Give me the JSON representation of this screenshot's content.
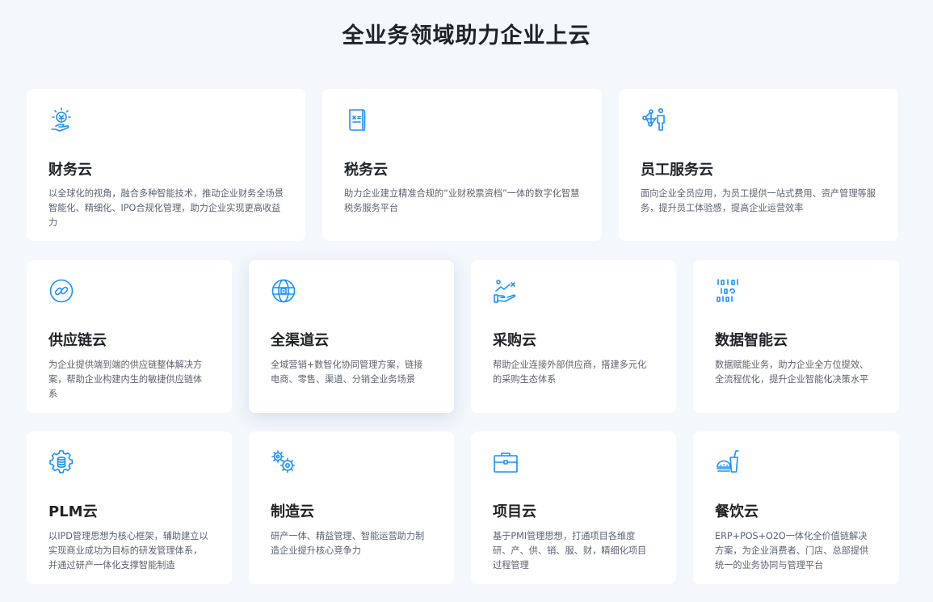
{
  "page": {
    "title": "全业务领域助力企业上云"
  },
  "colors": {
    "accent": "#1890ff",
    "background": "#f4f7fc",
    "card": "#ffffff"
  },
  "cards": [
    {
      "icon": "finance-coin-hand-icon",
      "title": "财务云",
      "desc": "以全球化的视角，融合多种智能技术，推动企业财务全场景智能化、精细化、IPO合规化管理，助力企业实现更高收益力"
    },
    {
      "icon": "tax-receipt-icon",
      "title": "税务云",
      "desc": "助力企业建立精准合规的“业财税票资档”一体的数字化智慧税务服务平台"
    },
    {
      "icon": "employee-network-icon",
      "title": "员工服务云",
      "desc": "面向企业全员应用，为员工提供一站式费用、资产管理等服务，提升员工体验感，提高企业运营效率"
    },
    {
      "icon": "supply-chain-link-icon",
      "title": "供应链云",
      "desc": "为企业提供端到端的供应链整体解决方案，帮助企业构建内生的敏捷供应链体系"
    },
    {
      "icon": "omnichannel-globe-icon",
      "title": "全渠道云",
      "desc": "全域营销+数智化协同管理方案，链接电商、零售、渠道、分销全业务场景"
    },
    {
      "icon": "procurement-hand-chart-icon",
      "title": "采购云",
      "desc": "帮助企业连接外部供应商，搭建多元化的采购生态体系"
    },
    {
      "icon": "binary-data-icon",
      "title": "数据智能云",
      "desc": "数据赋能业务，助力企业全方位提效、全流程优化，提升企业智能化决策水平"
    },
    {
      "icon": "database-gear-icon",
      "title": "PLM云",
      "desc": "以IPD管理思想为核心框架，辅助建立以实现商业成功为目标的研发管理体系，并通过研产一体化支撑智能制造"
    },
    {
      "icon": "gears-icon",
      "title": "制造云",
      "desc": "研产一体、精益管理、智能运营助力制造企业提升核心竞争力"
    },
    {
      "icon": "project-briefcase-icon",
      "title": "项目云",
      "desc": "基于PMI管理思想，打通项目各维度研、产、供、销、服、财，精细化项目过程管理"
    },
    {
      "icon": "catering-food-drink-icon",
      "title": "餐饮云",
      "desc": "ERP+POS+O2O一体化全价值链解决方案，为企业消费者、门店、总部提供统一的业务协同与管理平台"
    }
  ]
}
